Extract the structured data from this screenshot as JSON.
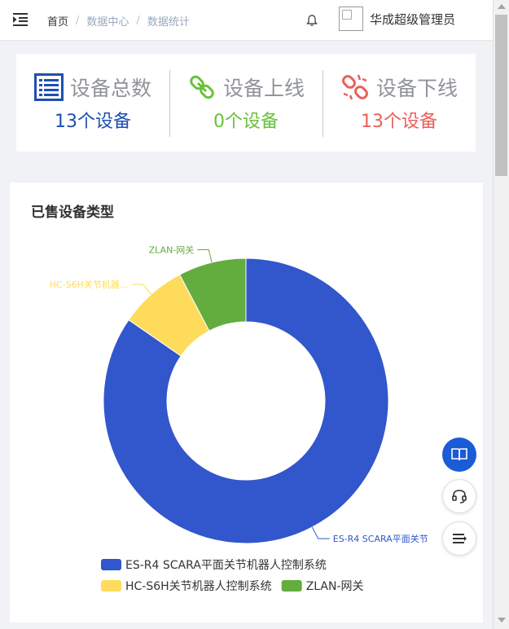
{
  "header": {
    "breadcrumb": [
      "首页",
      "数据中心",
      "数据统计"
    ],
    "username": "华成超级管理员"
  },
  "stats": [
    {
      "title": "设备总数",
      "value": "13个设备",
      "color": "#1f4fb0",
      "icon": "list-icon"
    },
    {
      "title": "设备上线",
      "value": "0个设备",
      "color": "#67c23a",
      "icon": "link-icon"
    },
    {
      "title": "设备下线",
      "value": "13个设备",
      "color": "#e8615a",
      "icon": "unlink-icon"
    }
  ],
  "card": {
    "title": "已售设备类型"
  },
  "colors": {
    "blue": "#3256cb",
    "yellow": "#ffdb5c",
    "green": "#62ad3e",
    "fab_blue": "#1a5bd6"
  },
  "chart_data": {
    "type": "pie",
    "donut": true,
    "title": "",
    "categories": [
      "ES-R4 SCARA平面关节机器人控制系统",
      "HC-S6H关节机器人控制系统",
      "ZLAN-网关"
    ],
    "values": [
      11,
      1,
      1
    ],
    "outside_labels": [
      "ES-R4 SCARA平面关节",
      "HC-S6H关节机器...",
      "ZLAN-网关"
    ],
    "legend": "bottom"
  },
  "fabs": [
    "book-icon",
    "headset-icon",
    "menu-icon"
  ]
}
